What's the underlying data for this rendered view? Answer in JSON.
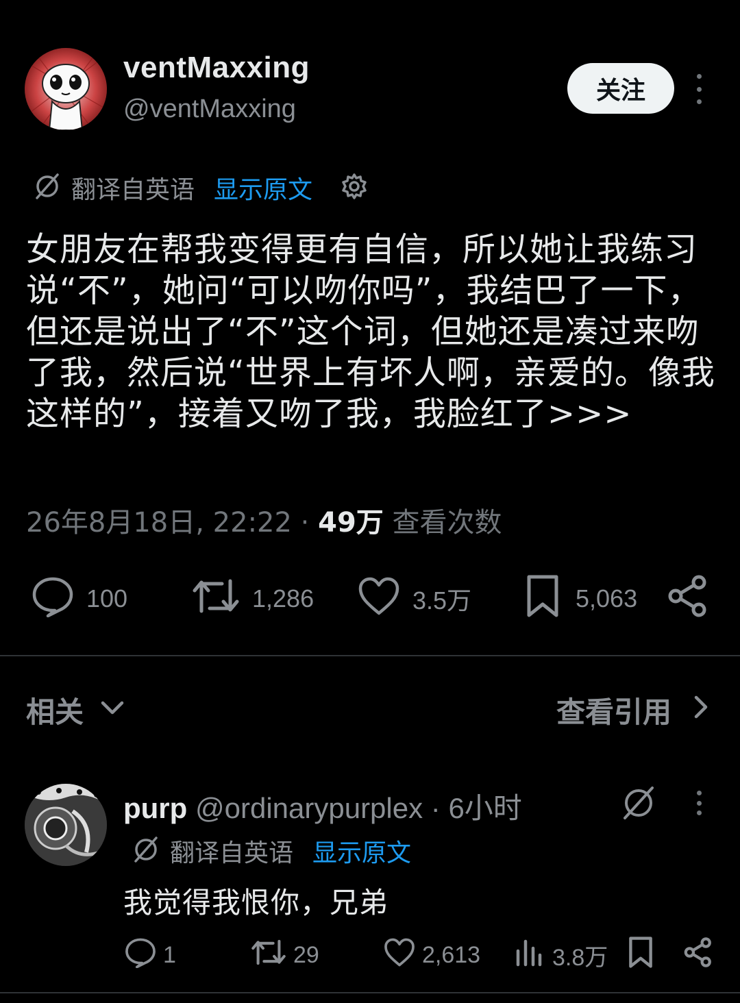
{
  "post": {
    "display_name": "ventMaxxing",
    "handle": "@ventMaxxing",
    "follow_label": "关注",
    "translated_from": "翻译自英语",
    "show_original": "显示原文",
    "body": "女朋友在帮我变得更有自信，所以她让我练习说“不”，她问“可以吻你吗”，我结巴了一下，但还是说出了“不”这个词，但她还是凑过来吻了我，然后说“世界上有坏人啊，亲爱的。像我这样的”，接着又吻了我，我脸红了>>>",
    "date": "26年8月18日, 22:22",
    "separator": "·",
    "views_count": "49万",
    "views_label": "查看次数",
    "stats": {
      "replies": "100",
      "reposts": "1,286",
      "likes": "3.5万",
      "bookmarks": "5,063"
    }
  },
  "related_section": {
    "related_label": "相关",
    "view_quotes_label": "查看引用"
  },
  "reply": {
    "display_name": "purp",
    "handle": "@ordinarypurplex",
    "separator": "·",
    "time": "6小时",
    "translated_from": "翻译自英语",
    "show_original": "显示原文",
    "text": "我觉得我恨你，兄弟",
    "stats": {
      "replies": "1",
      "reposts": "29",
      "likes": "2,613",
      "views": "3.8万"
    }
  },
  "icons": {
    "translate": "translate-icon",
    "gear": "gear-icon",
    "reply": "reply-icon",
    "repost": "repost-icon",
    "like": "heart-icon",
    "bookmark": "bookmark-icon",
    "share": "share-icon",
    "views": "views-bar-icon",
    "chevron_down": "chevron-down-icon",
    "chevron_right": "chevron-right-icon",
    "more": "more-vertical-icon"
  },
  "colors": {
    "background": "#000000",
    "text_primary": "#e7e9ea",
    "text_secondary": "#71767b",
    "link": "#1d9bf0",
    "follow_button_bg": "#eff3f4"
  }
}
